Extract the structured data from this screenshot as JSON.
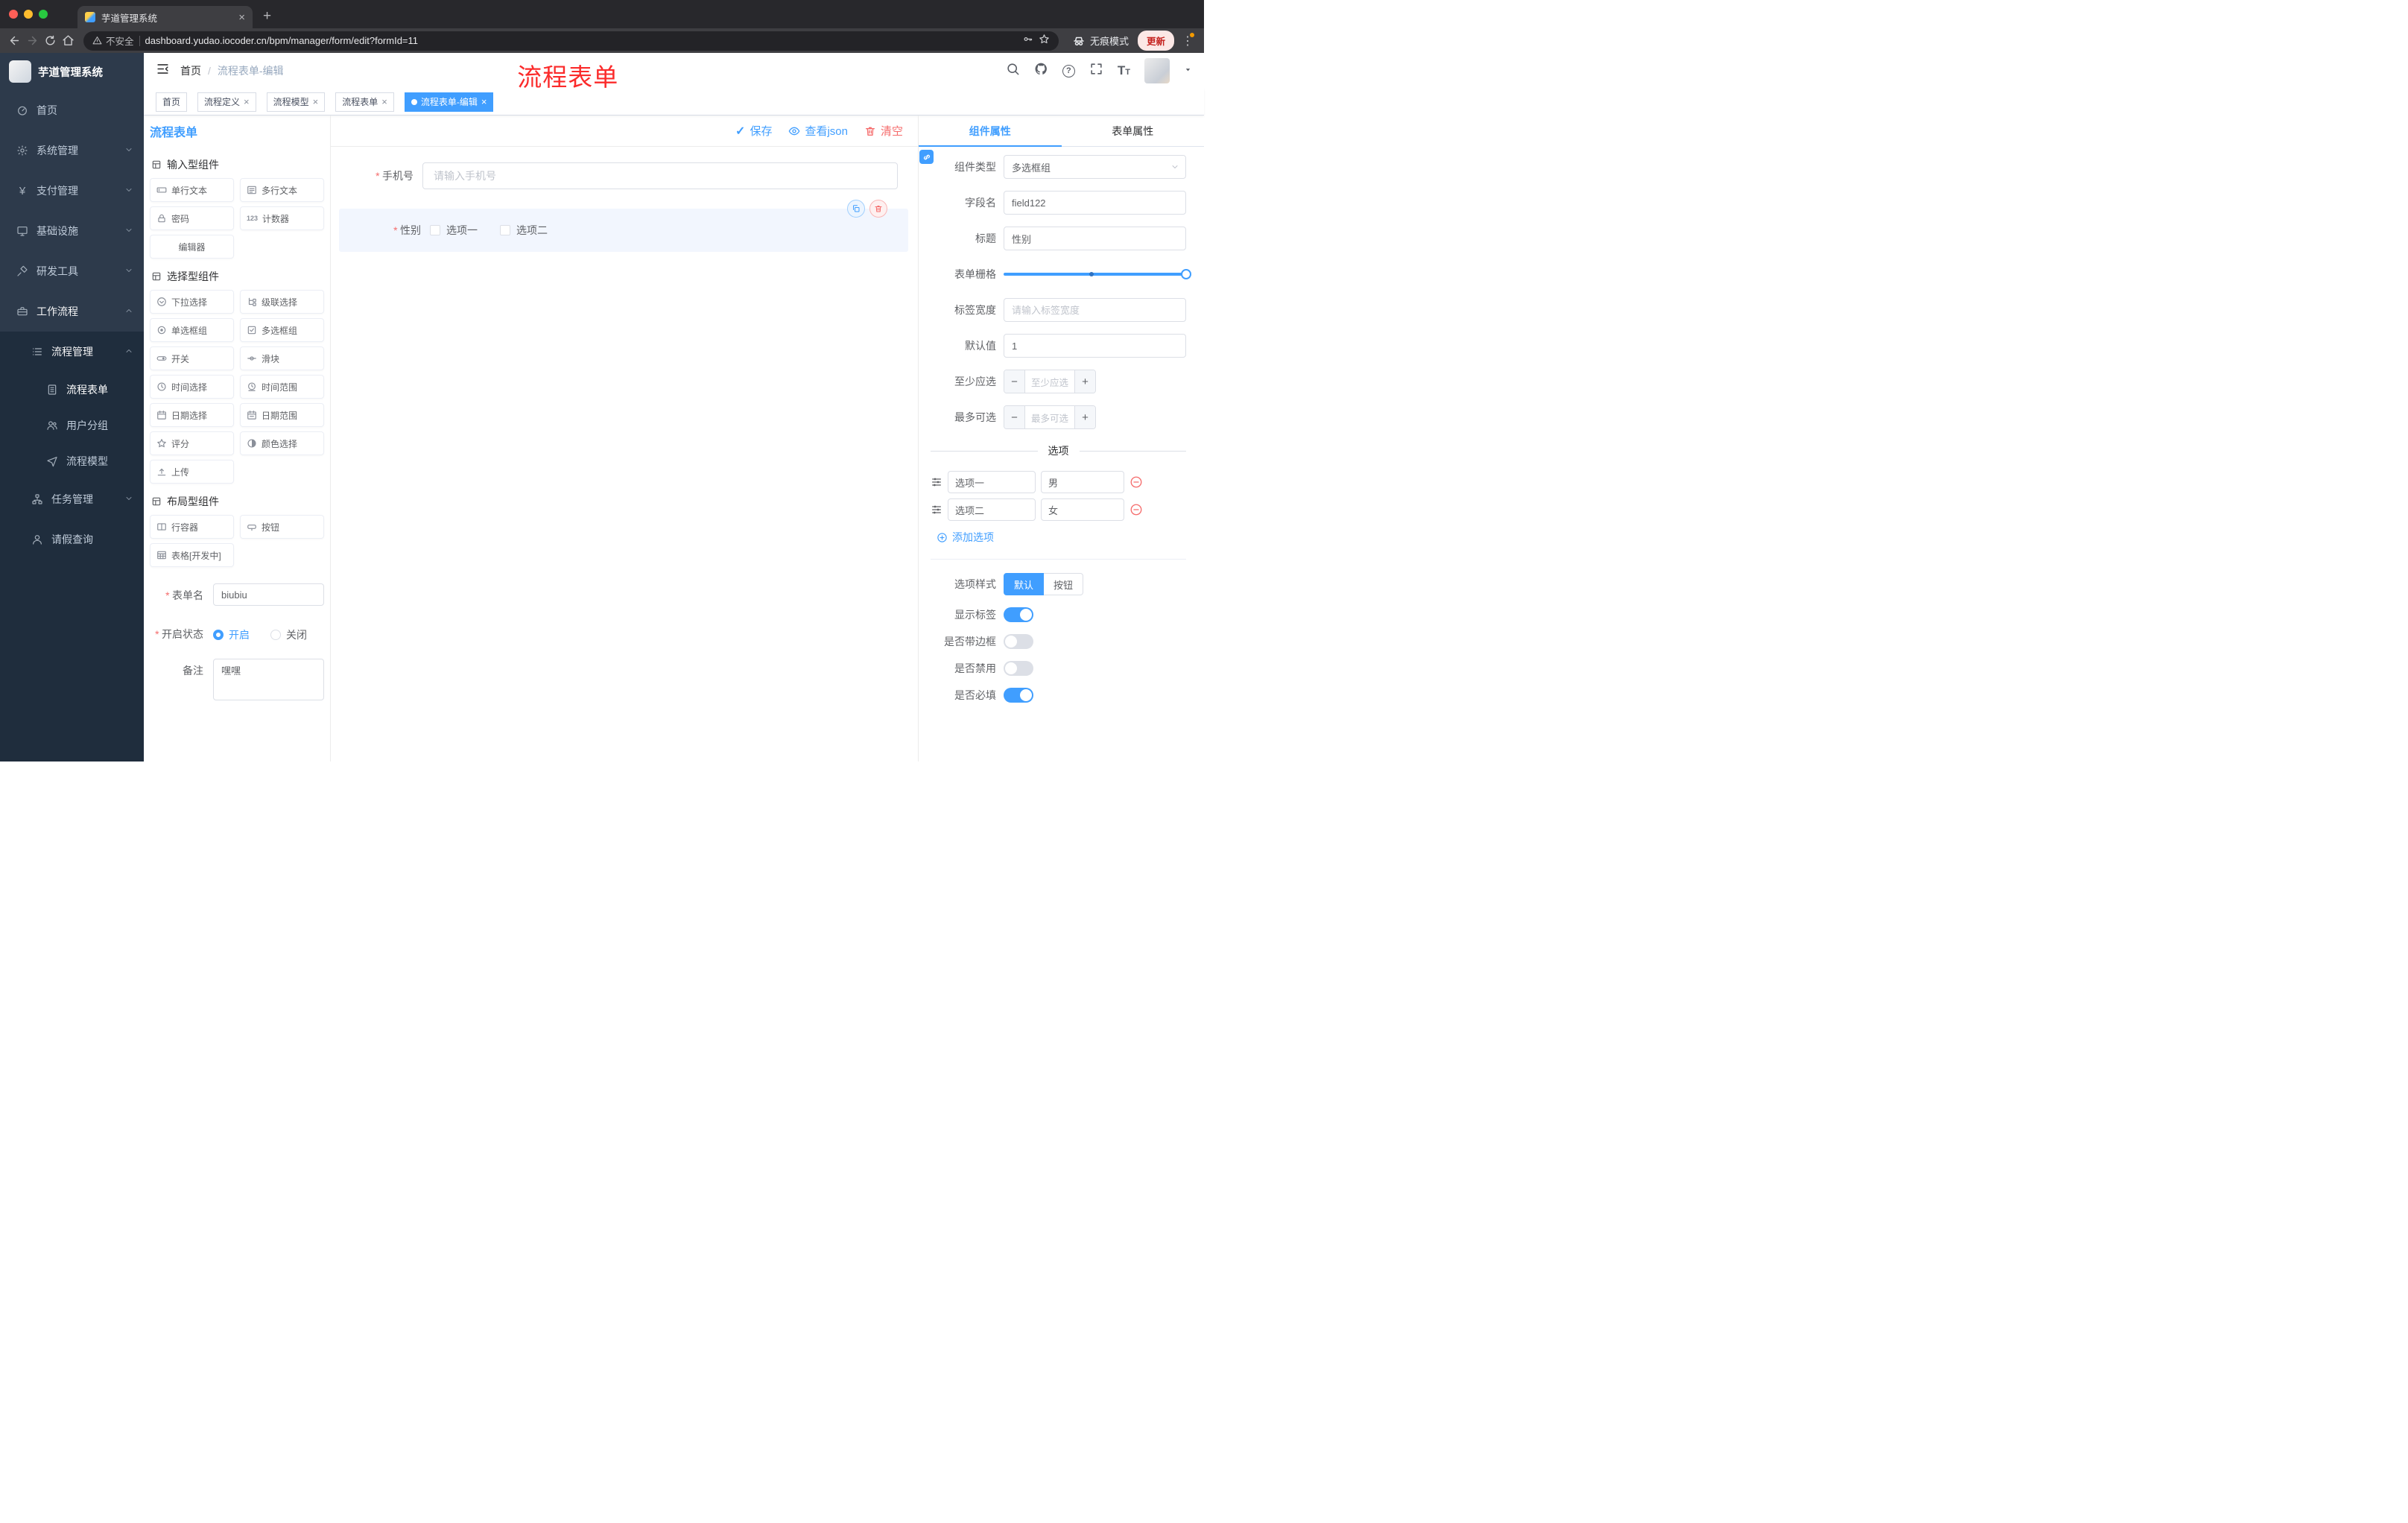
{
  "browser": {
    "tab_title": "芋道管理系统",
    "security_label": "不安全",
    "url": "dashboard.yudao.iocoder.cn/bpm/manager/form/edit?formId=11",
    "incognito_label": "无痕模式",
    "update_label": "更新"
  },
  "sidebar": {
    "logo_title": "芋道管理系统",
    "items": [
      "首页",
      "系统管理",
      "支付管理",
      "基础设施",
      "研发工具",
      "工作流程"
    ],
    "submenu": {
      "process_mgmt": "流程管理",
      "process_form": "流程表单",
      "user_group": "用户分组",
      "process_model": "流程模型",
      "task_mgmt": "任务管理",
      "leave_query": "请假查询"
    }
  },
  "header": {
    "breadcrumb_home": "首页",
    "breadcrumb_current": "流程表单-编辑",
    "annotation": "流程表单"
  },
  "tags": [
    "首页",
    "流程定义",
    "流程模型",
    "流程表单",
    "流程表单-编辑"
  ],
  "page": {
    "title": "流程表单",
    "save": "保存",
    "view_json": "查看json",
    "clear": "清空"
  },
  "palette": {
    "groups": [
      {
        "title": "输入型组件",
        "items": [
          {
            "label": "单行文本",
            "icon": "text-field-icon"
          },
          {
            "label": "多行文本",
            "icon": "textarea-icon"
          },
          {
            "label": "密码",
            "icon": "lock-icon"
          },
          {
            "label": "计数器",
            "icon": "counter-icon"
          },
          {
            "label": "编辑器",
            "icon": "editor-icon"
          }
        ]
      },
      {
        "title": "选择型组件",
        "items": [
          {
            "label": "下拉选择",
            "icon": "select-icon"
          },
          {
            "label": "级联选择",
            "icon": "cascader-icon"
          },
          {
            "label": "单选框组",
            "icon": "radio-group-icon"
          },
          {
            "label": "多选框组",
            "icon": "checkbox-group-icon"
          },
          {
            "label": "开关",
            "icon": "switch-icon"
          },
          {
            "label": "滑块",
            "icon": "slider-icon"
          },
          {
            "label": "时间选择",
            "icon": "time-picker-icon"
          },
          {
            "label": "时间范围",
            "icon": "time-range-icon"
          },
          {
            "label": "日期选择",
            "icon": "date-picker-icon"
          },
          {
            "label": "日期范围",
            "icon": "date-range-icon"
          },
          {
            "label": "评分",
            "icon": "rate-icon"
          },
          {
            "label": "颜色选择",
            "icon": "color-picker-icon"
          },
          {
            "label": "上传",
            "icon": "upload-icon"
          }
        ]
      },
      {
        "title": "布局型组件",
        "items": [
          {
            "label": "行容器",
            "icon": "row-container-icon"
          },
          {
            "label": "按钮",
            "icon": "button-icon"
          },
          {
            "label": "表格[开发中]",
            "icon": "table-icon"
          }
        ]
      }
    ],
    "form": {
      "name_label": "表单名",
      "name_value": "biubiu",
      "status_label": "开启状态",
      "status_on": "开启",
      "status_off": "关闭",
      "remark_label": "备注",
      "remark_value": "嘿嘿"
    }
  },
  "canvas": {
    "phone_field": {
      "label": "手机号",
      "placeholder": "请输入手机号"
    },
    "gender_field": {
      "label": "性别",
      "options": [
        "选项一",
        "选项二"
      ]
    }
  },
  "inspector": {
    "tab_component": "组件属性",
    "tab_form": "表单属性",
    "component_type": {
      "label": "组件类型",
      "value": "多选框组"
    },
    "field_name": {
      "label": "字段名",
      "value": "field122"
    },
    "title": {
      "label": "标题",
      "value": "性别"
    },
    "grid": {
      "label": "表单栅格"
    },
    "label_width": {
      "label": "标签宽度",
      "placeholder": "请输入标签宽度"
    },
    "default_value": {
      "label": "默认值",
      "value": "1"
    },
    "min_select": {
      "label": "至少应选",
      "placeholder": "至少应选"
    },
    "max_select": {
      "label": "最多可选",
      "placeholder": "最多可选"
    },
    "options_title": "选项",
    "options": [
      {
        "name": "选项一",
        "value": "男"
      },
      {
        "name": "选项二",
        "value": "女"
      }
    ],
    "add_option": "添加选项",
    "option_style": {
      "label": "选项样式",
      "default": "默认",
      "button": "按钮"
    },
    "show_label": "显示标签",
    "bordered": "是否带边框",
    "disabled": "是否禁用",
    "required": "是否必填"
  },
  "colors": {
    "accent": "#409eff",
    "danger": "#f56c6c",
    "annotation": "#fb2b2b",
    "sidebar": "#2d3a4b",
    "sidebar_sub": "#1f2d3d"
  }
}
